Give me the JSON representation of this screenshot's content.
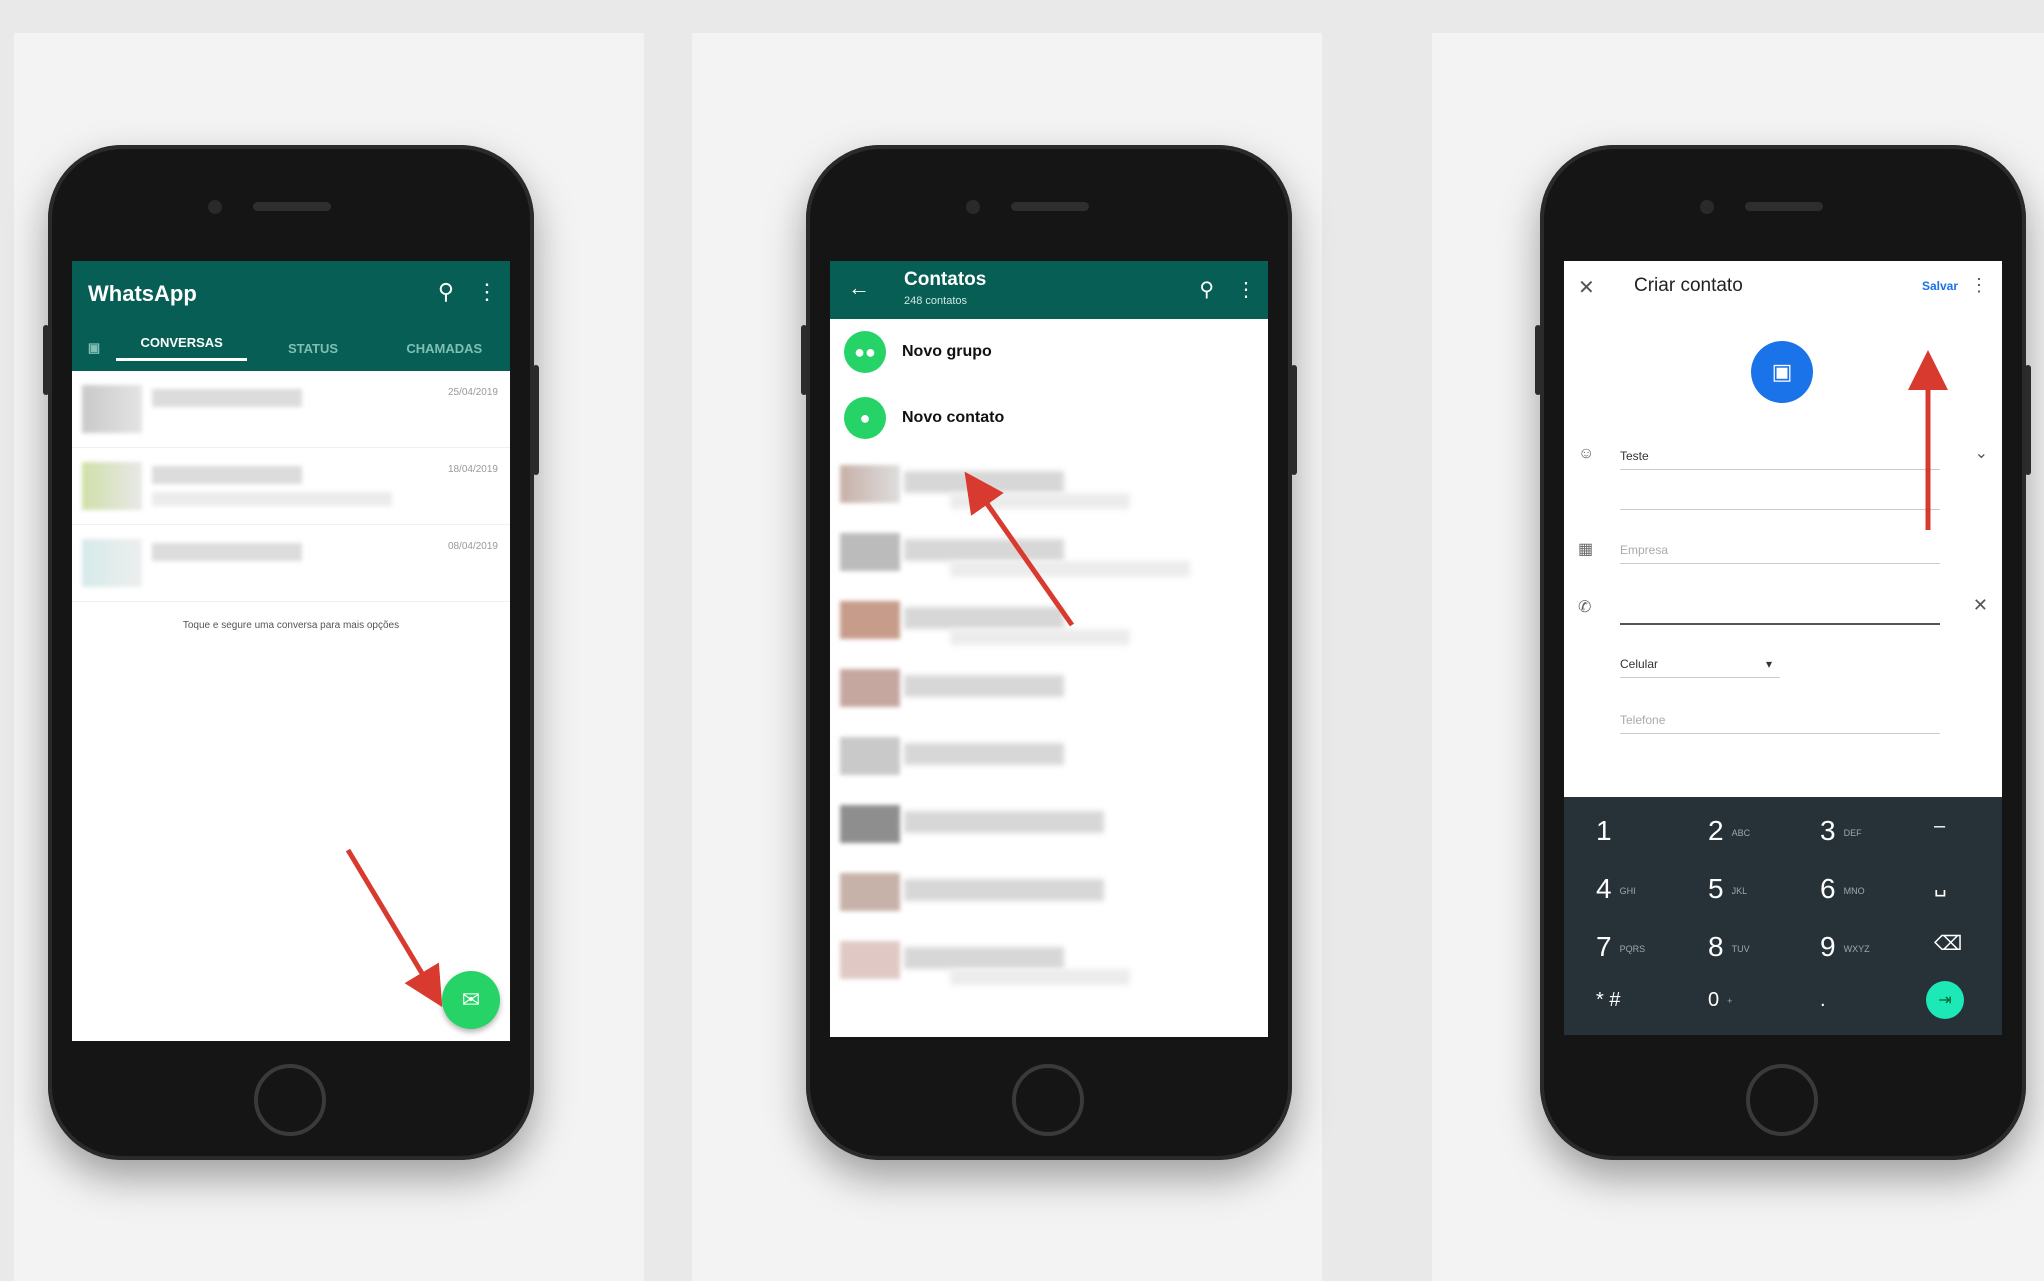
{
  "colors": {
    "teal": "#075e54",
    "green": "#25d366",
    "blue": "#1a73e8",
    "keypad": "#263238",
    "arrow": "#d93a2f"
  },
  "screen1": {
    "title": "WhatsApp",
    "tabs": [
      "CONVERSAS",
      "STATUS",
      "CHAMADAS"
    ],
    "chats": [
      {
        "date": "25/04/2019"
      },
      {
        "date": "18/04/2019"
      },
      {
        "date": "08/04/2019"
      }
    ],
    "hint": "Toque e segure uma conversa para mais opções",
    "icons": {
      "search": "search-icon",
      "more": "more-vert-icon",
      "camera": "camera-icon",
      "fab": "new-chat-icon"
    }
  },
  "screen2": {
    "title": "Contatos",
    "subtitle": "248 contatos",
    "items": [
      {
        "label": "Novo grupo",
        "icon": "group-icon"
      },
      {
        "label": "Novo contato",
        "icon": "person-icon"
      }
    ]
  },
  "screen3": {
    "title": "Criar contato",
    "save": "Salvar",
    "name_value": "Teste",
    "company_placeholder": "Empresa",
    "phone_type": "Celular",
    "phone_placeholder": "Telefone",
    "keys": [
      {
        "d": "1",
        "l": ""
      },
      {
        "d": "2",
        "l": "ABC"
      },
      {
        "d": "3",
        "l": "DEF"
      },
      {
        "d": "–",
        "l": ""
      },
      {
        "d": "4",
        "l": "GHI"
      },
      {
        "d": "5",
        "l": "JKL"
      },
      {
        "d": "6",
        "l": "MNO"
      },
      {
        "d": "␣",
        "l": ""
      },
      {
        "d": "7",
        "l": "PQRS"
      },
      {
        "d": "8",
        "l": "TUV"
      },
      {
        "d": "9",
        "l": "WXYZ"
      },
      {
        "d": "⌫",
        "l": ""
      },
      {
        "d": "* #",
        "l": ""
      },
      {
        "d": "0",
        "l": "+"
      },
      {
        "d": ".",
        "l": ""
      }
    ]
  }
}
